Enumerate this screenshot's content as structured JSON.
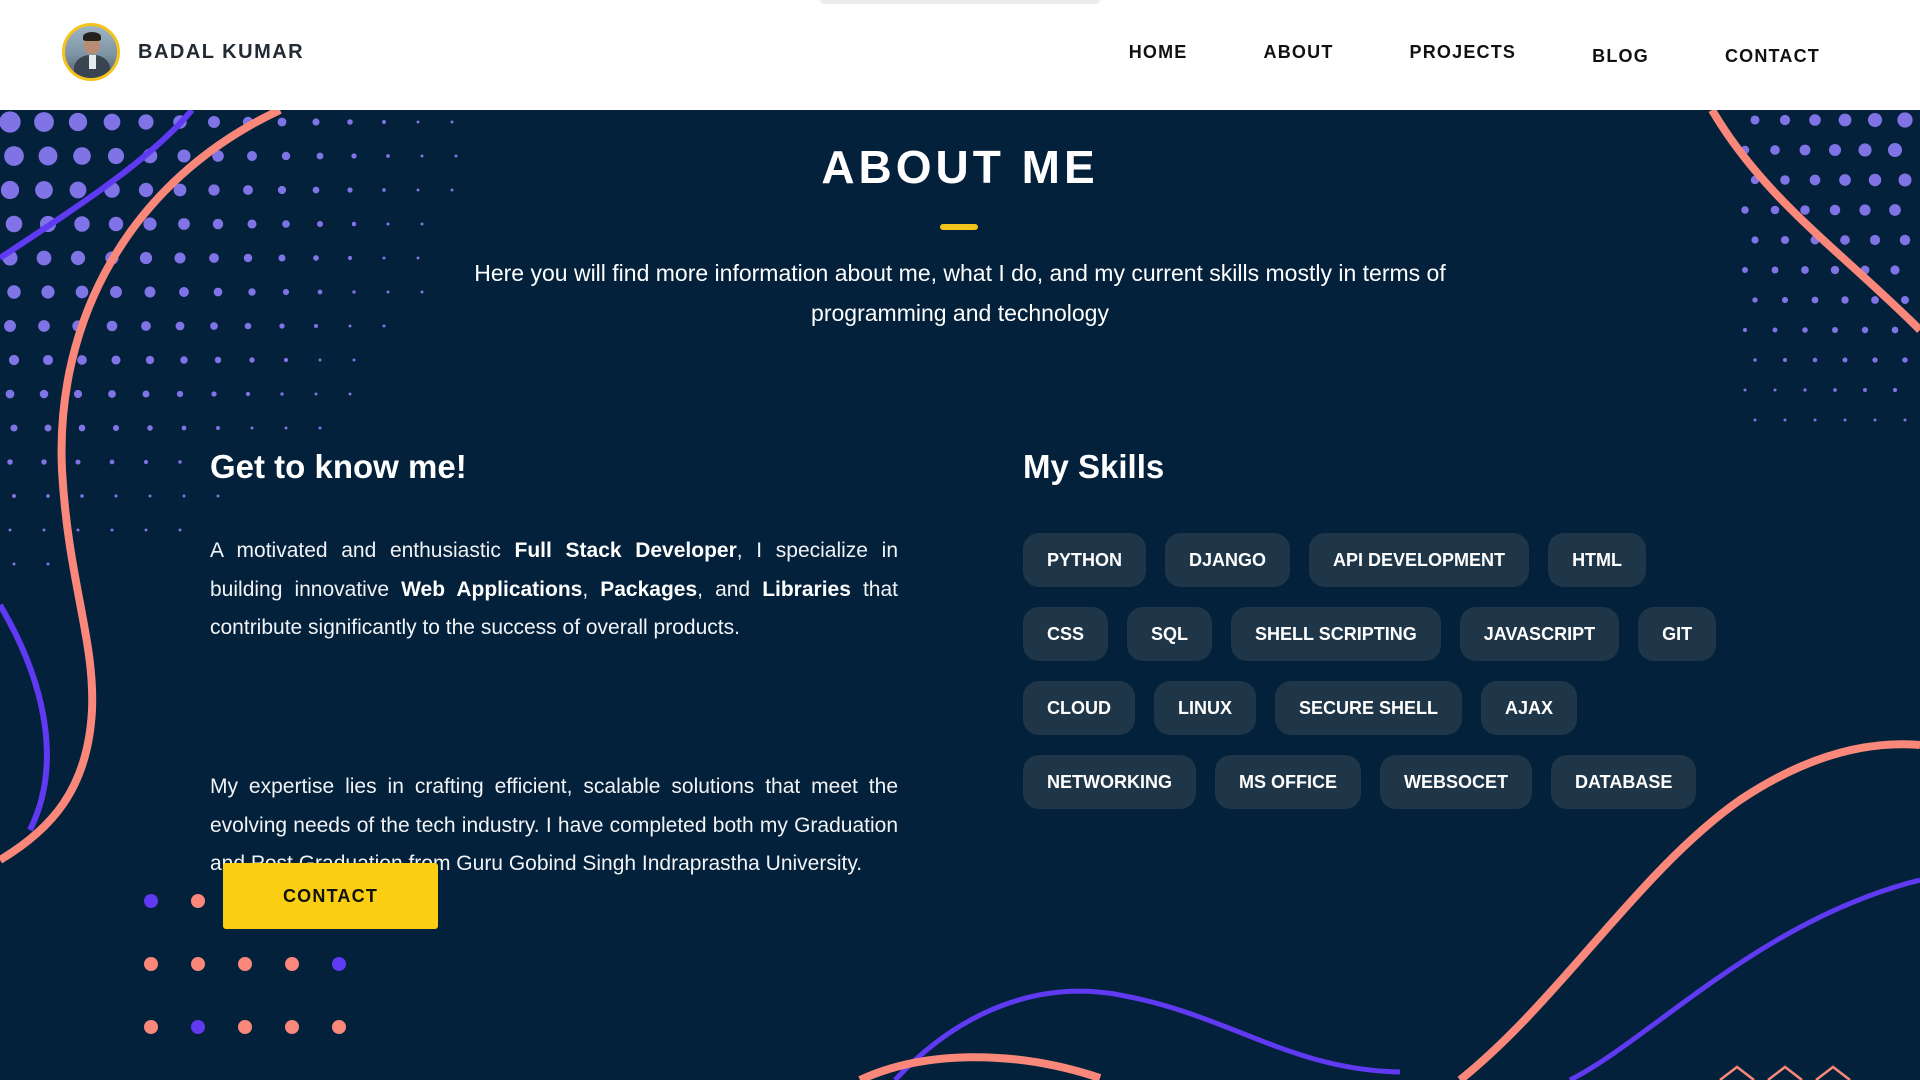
{
  "brand": {
    "name": "BADAL KUMAR"
  },
  "nav": [
    {
      "label": "HOME"
    },
    {
      "label": "ABOUT"
    },
    {
      "label": "PROJECTS"
    },
    {
      "label": "BLOG"
    },
    {
      "label": "CONTACT"
    }
  ],
  "about": {
    "title": "ABOUT ME",
    "intro": "Here you will find more information about me, what I do, and my current skills mostly in terms of programming and technology"
  },
  "know_me": {
    "title": "Get to know me!",
    "p1": {
      "t1": "A motivated and enthusiastic ",
      "b1": "Full Stack Developer",
      "t2": ", I specialize in building innovative ",
      "b2": "Web Applications",
      "t3": ", ",
      "b3": "Packages",
      "t4": ", and ",
      "b4": "Libraries",
      "t5": " that contribute significantly to the success of overall products."
    },
    "p2": "My expertise lies in crafting efficient, scalable solutions that meet the evolving needs of the tech industry. I have completed both my Graduation and Post Graduation from Guru Gobind Singh Indraprastha University.",
    "contact_button": "CONTACT"
  },
  "skills": {
    "title": "My Skills",
    "items": [
      "PYTHON",
      "DJANGO",
      "API DEVELOPMENT",
      "HTML",
      "CSS",
      "SQL",
      "SHELL SCRIPTING",
      "JAVASCRIPT",
      "GIT",
      "CLOUD",
      "LINUX",
      "SECURE SHELL",
      "AJAX",
      "NETWORKING",
      "MS OFFICE",
      "WEBSOCET",
      "DATABASE"
    ]
  },
  "colors": {
    "background": "#03213a",
    "accent_yellow": "#facf11",
    "chip_bg": "#1f3649",
    "deco_coral": "#f9877a",
    "deco_violet": "#5f3af2",
    "deco_dot_violet": "#7f73e6"
  },
  "icons": {
    "avatar": "profile-photo"
  }
}
